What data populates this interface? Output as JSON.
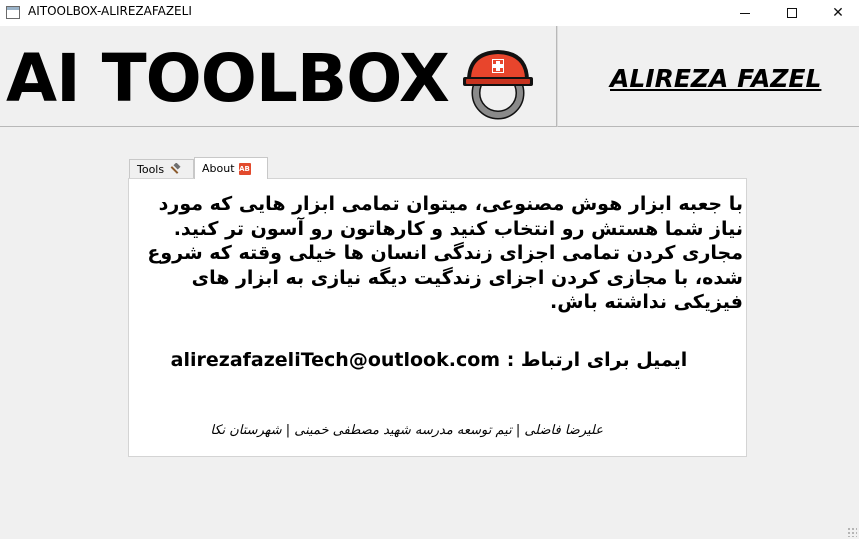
{
  "window": {
    "title": "AITOOLBOX-ALIREZAFAZELI"
  },
  "header": {
    "title": "AI TOOLBOX",
    "logo_icon": "helmet-icon",
    "author": "ALIREZA FAZEL"
  },
  "tabs": [
    {
      "label": "Tools",
      "icon": "hammer-icon",
      "selected": false
    },
    {
      "label": "About",
      "icon": "ab-icon",
      "selected": true
    }
  ],
  "about": {
    "description": "با جعبه ابزار هوش مصنوعی، میتوان تمامی ابزار هایی که مورد نیاز شما هستش رو انتخاب کنید و کارهاتون رو آسون تر کنید. مجاری کردن تمامی اجزای زندگی انسان ها خیلی وقته که شروع شده، با مجازی کردن اجزای زندگیت دیگه نیازی به ابزار های فیزیکی نداشته باش.",
    "contact": "ایمیل برای ارتباط : alirezafazeliTech@outlook.com",
    "credits": "علیرضا فاضلی | تیم توسعه مدرسه شهید مصطفی خمینی | شهرستان نکا"
  },
  "colors": {
    "background": "#f0f0f0",
    "panel": "#ffffff",
    "helmet_red": "#e8452c",
    "helmet_gray": "#7a7a7a"
  }
}
